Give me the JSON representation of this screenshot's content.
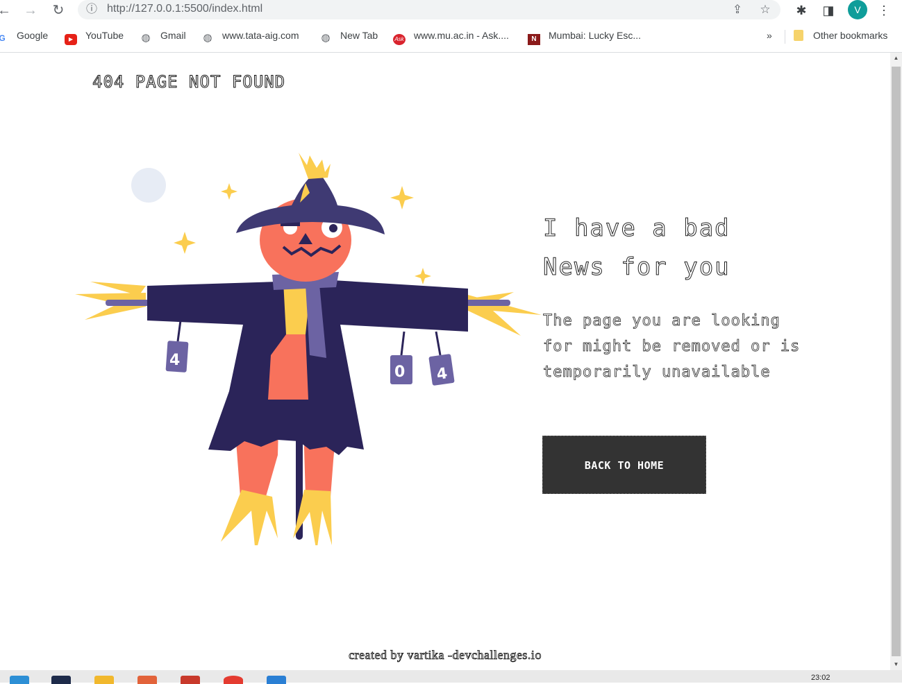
{
  "browser": {
    "url": "http://127.0.0.1:5500/index.html",
    "avatar_letter": "V"
  },
  "bookmarks": [
    {
      "label": "Google",
      "icon": "google-icon"
    },
    {
      "label": "YouTube",
      "icon": "youtube-icon"
    },
    {
      "label": "Gmail",
      "icon": "globe-icon"
    },
    {
      "label": "www.tata-aig.com",
      "icon": "globe-icon"
    },
    {
      "label": "New Tab",
      "icon": "globe-icon"
    },
    {
      "label": "www.mu.ac.in - Ask....",
      "icon": "ask-icon"
    },
    {
      "label": "Mumbai: Lucky Esc...",
      "icon": "news-icon"
    }
  ],
  "bookmarks_more": "»",
  "other_bookmarks": "Other bookmarks",
  "page": {
    "title": "404 PAGE NOT FOUND",
    "headline": "I have a bad News for you",
    "subtext": "The page you are looking for might be removed or is temporarily unavailable",
    "button_label": "BACK TO HOME",
    "footer": "created by vartika -devchallenges.io",
    "can_labels": [
      "4",
      "0",
      "4"
    ]
  },
  "taskbar": {
    "clock": "23:02"
  },
  "colors": {
    "hat": "#3f3a73",
    "coat": "#2b2459",
    "body": "#f8725c",
    "straw": "#fbcd4e",
    "scarf": "#6c63a3",
    "button_bg": "#333333",
    "moon": "#e7ecf5"
  }
}
